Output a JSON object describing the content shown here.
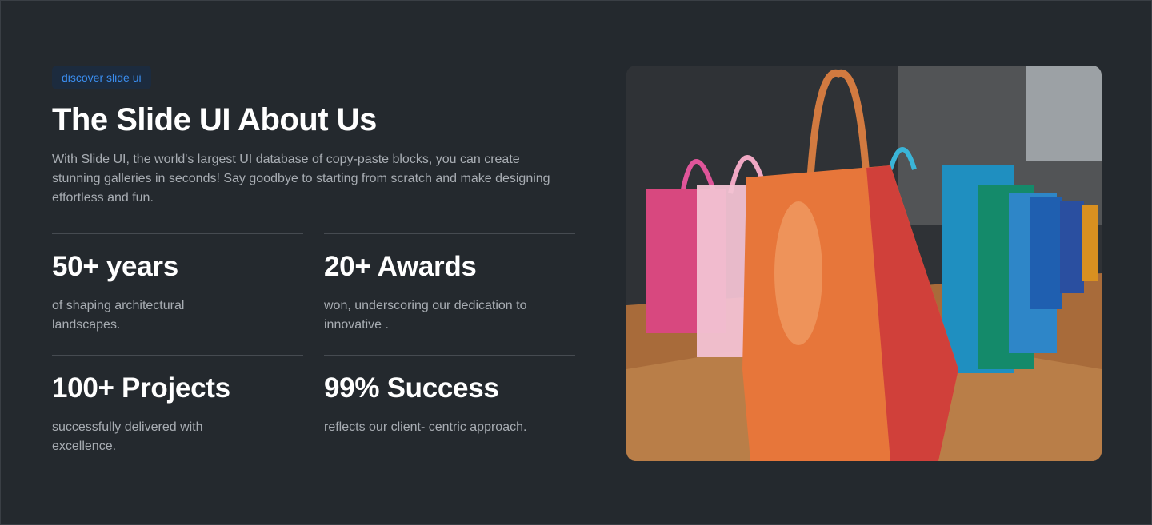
{
  "badge": "discover slide ui",
  "title": "The Slide UI About Us",
  "description": "With Slide UI, the world's largest UI database of copy-paste blocks, you can create stunning galleries in seconds! Say goodbye to starting from scratch and make designing effortless and fun.",
  "stats": [
    {
      "value": "50+ years",
      "text": "of shaping architectural landscapes."
    },
    {
      "value": "20+ Awards",
      "text": "won, underscoring our dedication to innovative ."
    },
    {
      "value": "100+ Projects",
      "text": "successfully delivered with excellence."
    },
    {
      "value": "99% Success",
      "text": "reflects our client- centric approach."
    }
  ],
  "colors": {
    "background": "#24292e",
    "accent": "#3b8ef0"
  }
}
